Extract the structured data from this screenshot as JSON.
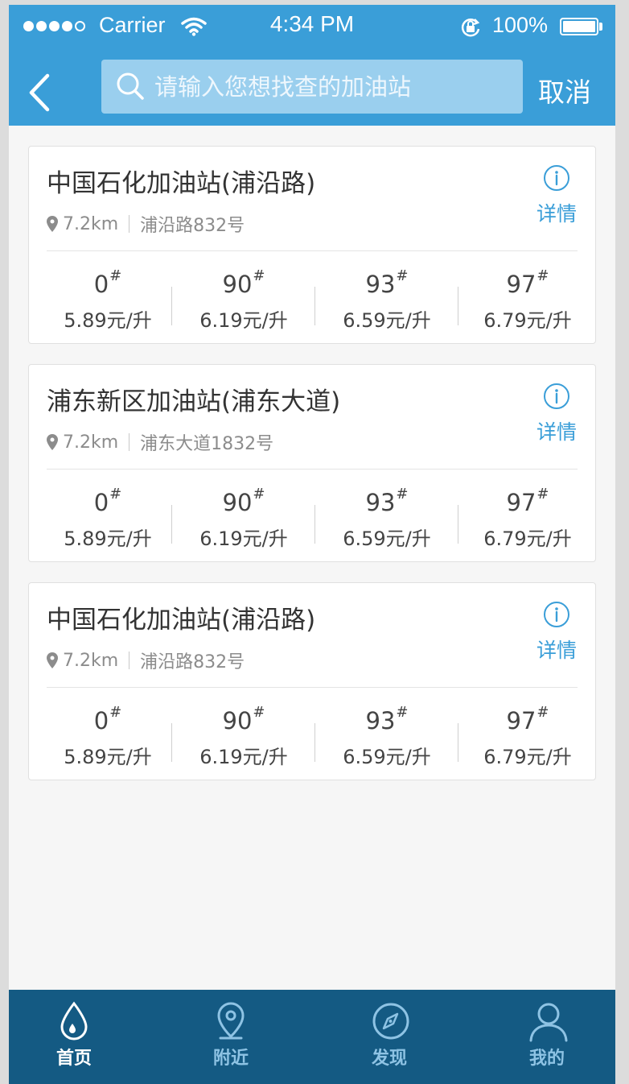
{
  "status_bar": {
    "carrier": "Carrier",
    "time": "4:34 PM",
    "battery": "100%"
  },
  "header": {
    "search_placeholder": "请输入您想找查的加油站",
    "cancel_label": "取消"
  },
  "stations": [
    {
      "name": "中国石化加油站(浦沿路)",
      "distance": "7.2km",
      "address": "浦沿路832号",
      "detail_label": "详情",
      "prices": [
        {
          "grade": "0",
          "mark": "#",
          "price": "5.89元/升"
        },
        {
          "grade": "90",
          "mark": "#",
          "price": "6.19元/升"
        },
        {
          "grade": "93",
          "mark": "#",
          "price": "6.59元/升"
        },
        {
          "grade": "97",
          "mark": "#",
          "price": "6.79元/升"
        }
      ]
    },
    {
      "name": "浦东新区加油站(浦东大道)",
      "distance": "7.2km",
      "address": "浦东大道1832号",
      "detail_label": "详情",
      "prices": [
        {
          "grade": "0",
          "mark": "#",
          "price": "5.89元/升"
        },
        {
          "grade": "90",
          "mark": "#",
          "price": "6.19元/升"
        },
        {
          "grade": "93",
          "mark": "#",
          "price": "6.59元/升"
        },
        {
          "grade": "97",
          "mark": "#",
          "price": "6.79元/升"
        }
      ]
    },
    {
      "name": "中国石化加油站(浦沿路)",
      "distance": "7.2km",
      "address": "浦沿路832号",
      "detail_label": "详情",
      "prices": [
        {
          "grade": "0",
          "mark": "#",
          "price": "5.89元/升"
        },
        {
          "grade": "90",
          "mark": "#",
          "price": "6.19元/升"
        },
        {
          "grade": "93",
          "mark": "#",
          "price": "6.59元/升"
        },
        {
          "grade": "97",
          "mark": "#",
          "price": "6.79元/升"
        }
      ]
    }
  ],
  "tabbar": [
    {
      "label": "首页",
      "icon": "drop-icon",
      "active": true
    },
    {
      "label": "附近",
      "icon": "location-pin-icon",
      "active": false
    },
    {
      "label": "发现",
      "icon": "compass-icon",
      "active": false
    },
    {
      "label": "我的",
      "icon": "user-icon",
      "active": false
    }
  ],
  "colors": {
    "header": "#3a9ed8",
    "accent": "#3a9ed8",
    "tabbar": "#145a83"
  }
}
